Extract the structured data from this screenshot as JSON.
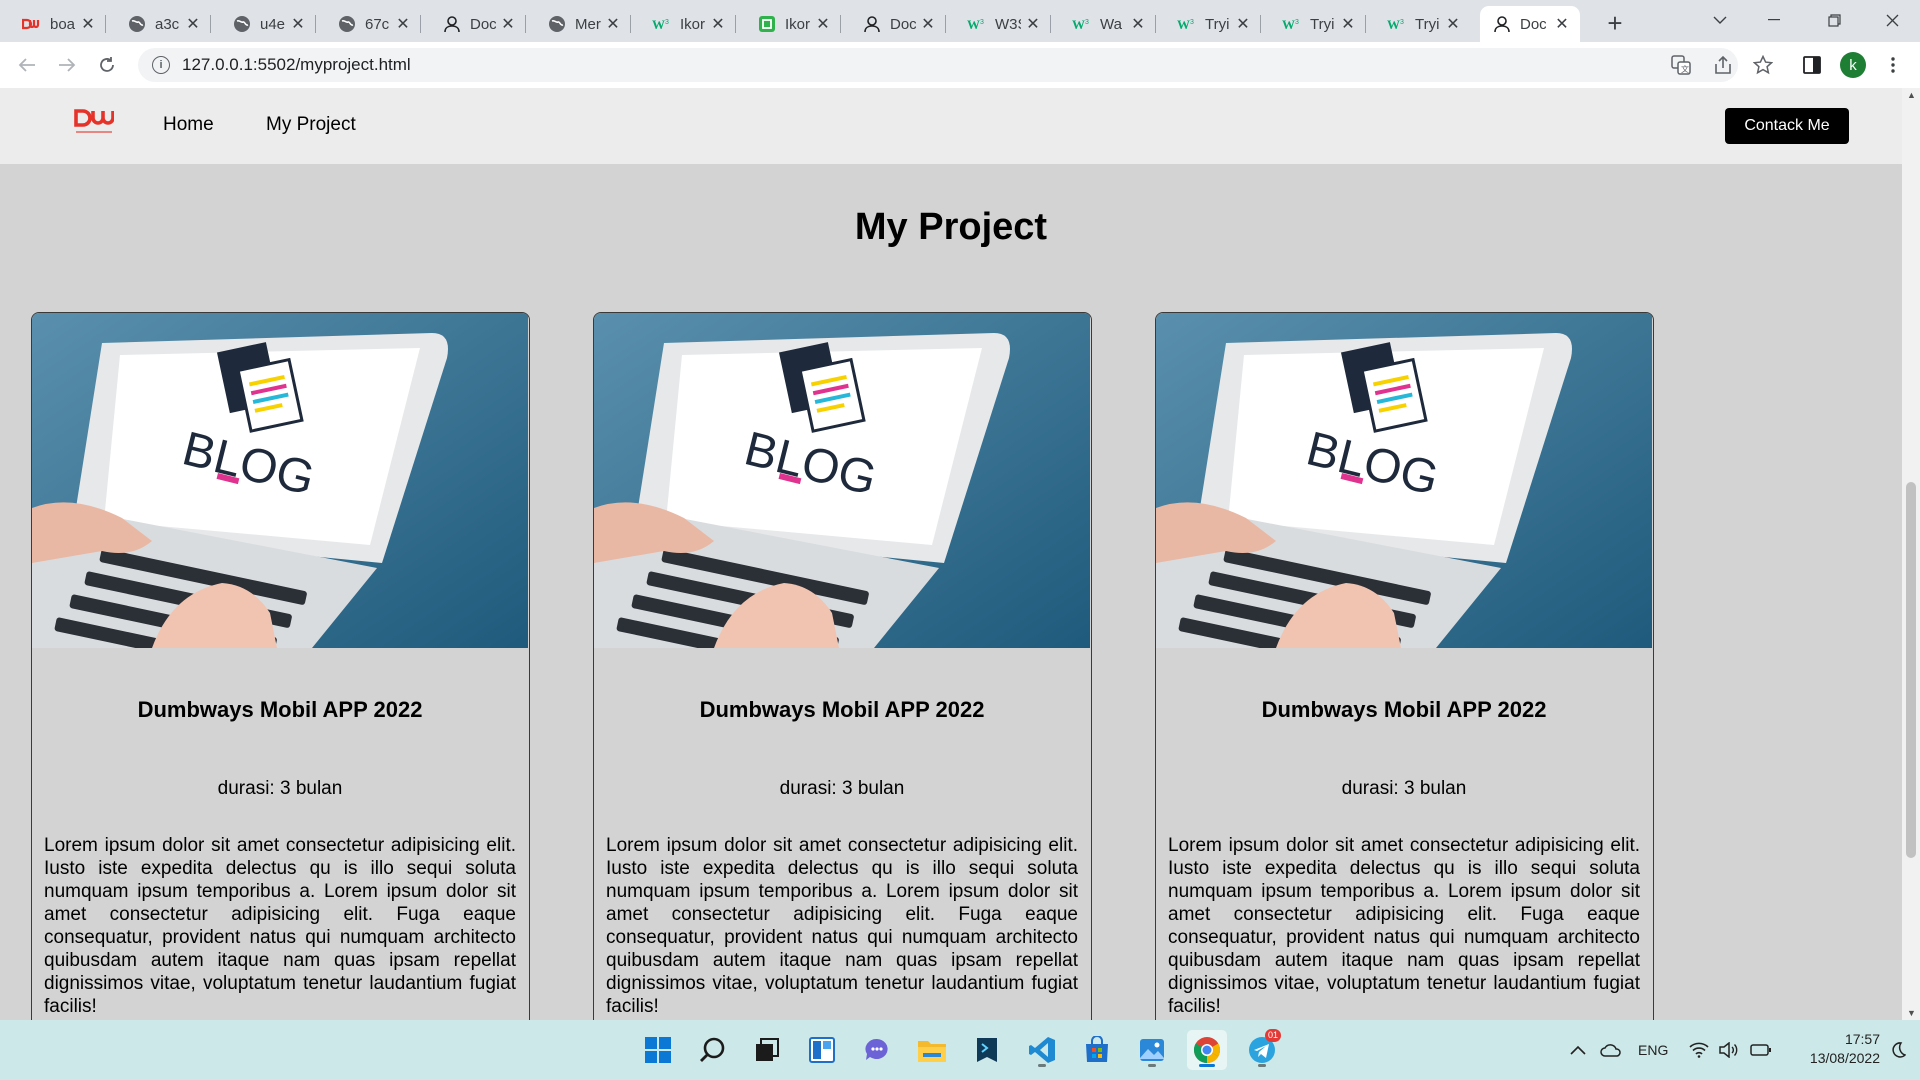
{
  "browser": {
    "tabs": [
      {
        "title": "boa",
        "icon": "dumbways-icon"
      },
      {
        "title": "a3c",
        "icon": "globe-icon"
      },
      {
        "title": "u4e",
        "icon": "globe-icon"
      },
      {
        "title": "67c",
        "icon": "globe-icon"
      },
      {
        "title": "Doc",
        "icon": "user-icon"
      },
      {
        "title": "Mer",
        "icon": "globe-icon"
      },
      {
        "title": "Ikor",
        "icon": "w3schools-icon"
      },
      {
        "title": "Ikor",
        "icon": "green-square-icon"
      },
      {
        "title": "Doc",
        "icon": "user-icon"
      },
      {
        "title": "W3S",
        "icon": "w3schools-icon"
      },
      {
        "title": "Wa",
        "icon": "w3schools-icon"
      },
      {
        "title": "Tryi",
        "icon": "w3schools-icon"
      },
      {
        "title": "Tryi",
        "icon": "w3schools-icon"
      },
      {
        "title": "Tryi",
        "icon": "w3schools-icon"
      },
      {
        "title": "Doc",
        "icon": "user-icon",
        "active": true
      }
    ],
    "url": "127.0.0.1:5502/myproject.html",
    "profile_initial": "k"
  },
  "site": {
    "nav": {
      "logo_text": "DW",
      "links": [
        "Home",
        "My Project"
      ],
      "contact_label": "Contack Me"
    },
    "page_title": "My Project",
    "cards": [
      {
        "image_text": "BLOG",
        "title": "Dumbways Mobil APP 2022",
        "duration": "durasi: 3 bulan",
        "description": "Lorem ipsum dolor sit amet consectetur adipisicing elit. Iusto iste expedita delectus qu is illo sequi soluta numquam ipsum temporibus a. Lorem ipsum dolor sit amet consectetur adipisicing elit. Fuga eaque consequatur, provident natus qui numquam architecto quibusdam autem itaque nam quas ipsam repellat dignissimos vitae, voluptatum tenetur laudantium fugiat facilis!"
      },
      {
        "image_text": "BLOG",
        "title": "Dumbways Mobil APP 2022",
        "duration": "durasi: 3 bulan",
        "description": "Lorem ipsum dolor sit amet consectetur adipisicing elit. Iusto iste expedita delectus qu is illo sequi soluta numquam ipsum temporibus a. Lorem ipsum dolor sit amet consectetur adipisicing elit. Fuga eaque consequatur, provident natus qui numquam architecto quibusdam autem itaque nam quas ipsam repellat dignissimos vitae, voluptatum tenetur laudantium fugiat facilis!"
      },
      {
        "image_text": "BLOG",
        "title": "Dumbways Mobil APP 2022",
        "duration": "durasi: 3 bulan",
        "description": "Lorem ipsum dolor sit amet consectetur adipisicing elit. Iusto iste expedita delectus qu is illo sequi soluta numquam ipsum temporibus a. Lorem ipsum dolor sit amet consectetur adipisicing elit. Fuga eaque consequatur, provident natus qui numquam architecto quibusdam autem itaque nam quas ipsam repellat dignissimos vitae, voluptatum tenetur laudantium fugiat facilis!"
      }
    ]
  },
  "taskbar": {
    "apps": [
      "windows-start-icon",
      "search-icon",
      "task-view-icon",
      "widgets-icon",
      "teams-chat-icon",
      "file-explorer-icon",
      "terminal-icon",
      "vscode-icon",
      "store-icon",
      "photos-icon",
      "chrome-icon",
      "telegram-icon"
    ],
    "telegram_badge": "01",
    "language": "ENG",
    "time": "17:57",
    "date": "13/08/2022"
  },
  "colors": {
    "page_background": "#d3d3d3",
    "nav_background": "#ececec",
    "contact_button": "#000000",
    "logo_red": "#e5332a",
    "taskbar": "#cde8e8"
  }
}
